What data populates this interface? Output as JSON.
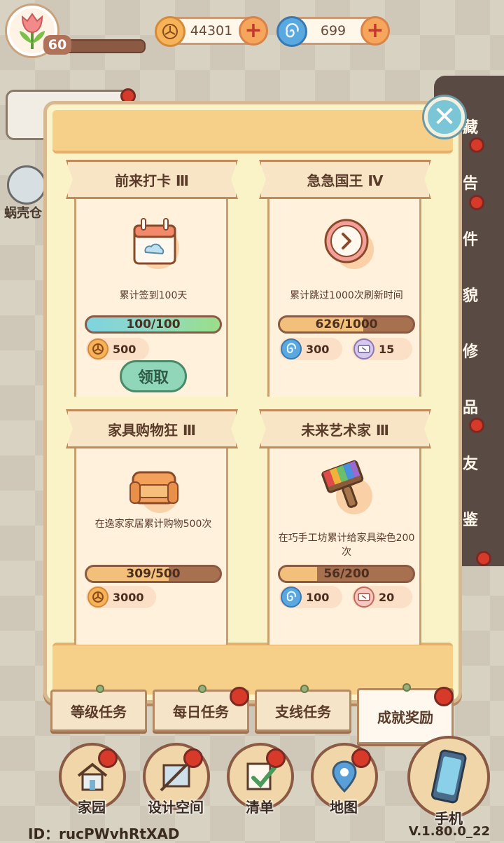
{
  "hud": {
    "level": "60",
    "xp_progress": 0.08,
    "coins": "44301",
    "swirls": "699",
    "plus_symbol": "+"
  },
  "side_menu": [
    "藏",
    "告",
    "件",
    "貌",
    "修",
    "品",
    "友",
    "鉴"
  ],
  "left_label": "蜗壳仓",
  "close_symbol": "✕",
  "cards": [
    {
      "title": "前来打卡 Ⅲ",
      "description": "累计签到100天",
      "progress_text": "100/100",
      "progress": 1.0,
      "rewards": [
        {
          "icon": "coin-icon",
          "amount": "500"
        }
      ],
      "claim_label": "领取"
    },
    {
      "title": "急急国王 Ⅳ",
      "description": "累计跳过1000次刷新时间",
      "progress_text": "626/1000",
      "progress": 0.626,
      "rewards": [
        {
          "icon": "swirl-icon",
          "amount": "300"
        },
        {
          "icon": "ticket-icon",
          "amount": "15"
        }
      ]
    },
    {
      "title": "家具购物狂 Ⅲ",
      "description": "在逸家家居累计购物500次",
      "progress_text": "309/500",
      "progress": 0.618,
      "rewards": [
        {
          "icon": "coin-icon",
          "amount": "3000"
        }
      ]
    },
    {
      "title": "未来艺术家 Ⅲ",
      "description": "在巧手工坊累计给家具染色200次",
      "progress_text": "56/200",
      "progress": 0.28,
      "rewards": [
        {
          "icon": "swirl-icon",
          "amount": "100"
        },
        {
          "icon": "ticket-icon",
          "amount": "20"
        }
      ]
    }
  ],
  "tabs": [
    "等级任务",
    "每日任务",
    "支线任务",
    "成就奖励"
  ],
  "active_tab": "成就奖励",
  "nav": [
    "家园",
    "设计空间",
    "清单",
    "地图",
    "手机"
  ],
  "footer": {
    "id": "ID：rucPWvhRtXAD",
    "version": "V.1.80.0_22"
  },
  "colors": {
    "complete_bar": "#8fd9c4",
    "progress_bar": "#f2c07a",
    "accent_red": "#d83a2a",
    "panel_bg": "#fbf3c8"
  }
}
